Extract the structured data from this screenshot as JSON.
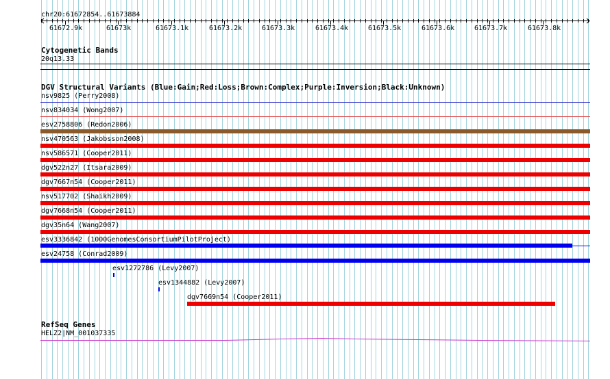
{
  "ruler": {
    "range_label": "chr20:61672854..61673884",
    "ticks": [
      "61672.9k",
      "61673k",
      "61673.1k",
      "61673.2k",
      "61673.3k",
      "61673.4k",
      "61673.5k",
      "61673.6k",
      "61673.7k",
      "61673.8k"
    ]
  },
  "cytoband": {
    "title": "Cytogenetic Bands",
    "band": "20q13.33"
  },
  "dgv": {
    "title": "DGV Structural Variants (Blue:Gain;Red:Loss;Brown:Complex;Purple:Inversion;Black:Unknown)",
    "variants": [
      {
        "label": "nsv9825 (Perry2008)",
        "type": "gain",
        "color": "#1f1fc8"
      },
      {
        "label": "nsv834034 (Wong2007)",
        "type": "loss",
        "color": "#e0484a"
      },
      {
        "label": "esv2758806 (Redon2006)",
        "type": "complex",
        "color": "#8b5a2b"
      },
      {
        "label": "nsv470563 (Jakobsson2008)",
        "type": "loss",
        "color": "#ee0000"
      },
      {
        "label": "nsv586571 (Cooper2011)",
        "type": "loss",
        "color": "#ee0000"
      },
      {
        "label": "dgv522n27 (Itsara2009)",
        "type": "loss",
        "color": "#ee0000"
      },
      {
        "label": "dgv7667n54 (Cooper2011)",
        "type": "loss",
        "color": "#ee0000"
      },
      {
        "label": "nsv517702 (Shaikh2009)",
        "type": "loss",
        "color": "#ee0000"
      },
      {
        "label": "dgv7668n54 (Cooper2011)",
        "type": "loss",
        "color": "#ee0000"
      },
      {
        "label": "dgv35n64 (Wang2007)",
        "type": "loss",
        "color": "#ee0000"
      },
      {
        "label": "esv3336842 (1000GenomesConsortiumPilotProject)",
        "type": "gain",
        "color": "#0000ee"
      },
      {
        "label": "esv24758 (Conrad2009)",
        "type": "gain",
        "color": "#0000ee"
      },
      {
        "label": "esv1272786 (Levy2007)",
        "type": "gain",
        "color": "#0000ee"
      },
      {
        "label": "esv1344882 (Levy2007)",
        "type": "gain",
        "color": "#0000ee"
      },
      {
        "label": "dgv7669n54 (Cooper2011)",
        "type": "loss",
        "color": "#ee0000"
      }
    ]
  },
  "refseq": {
    "title": "RefSeq Genes",
    "gene": "HELZ2|NM_001037335",
    "color": "#cc33cc"
  },
  "colors": {
    "grid": "#9fd3dc",
    "axis": "#000000"
  }
}
